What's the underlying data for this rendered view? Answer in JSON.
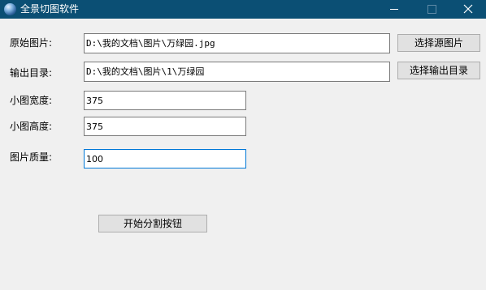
{
  "window": {
    "title": "全景切图软件"
  },
  "form": {
    "source_label": "原始图片:",
    "source_value": "D:\\我的文档\\图片\\万绿园.jpg",
    "source_button": "选择源图片",
    "output_label": "输出目录:",
    "output_value": "D:\\我的文档\\图片\\1\\万绿园",
    "output_button": "选择输出目录",
    "width_label": "小图宽度:",
    "width_value": "375",
    "height_label": "小图高度:",
    "height_value": "375",
    "quality_label": "图片质量:",
    "quality_value": "100",
    "start_button": "开始分割按钮"
  },
  "colors": {
    "titlebar": "#0b4f74",
    "background": "#f0f0f0",
    "focus_border": "#0078d7"
  },
  "icons": {
    "app": "globe-icon",
    "minimize": "minimize-icon",
    "maximize": "maximize-icon",
    "close": "close-icon"
  }
}
